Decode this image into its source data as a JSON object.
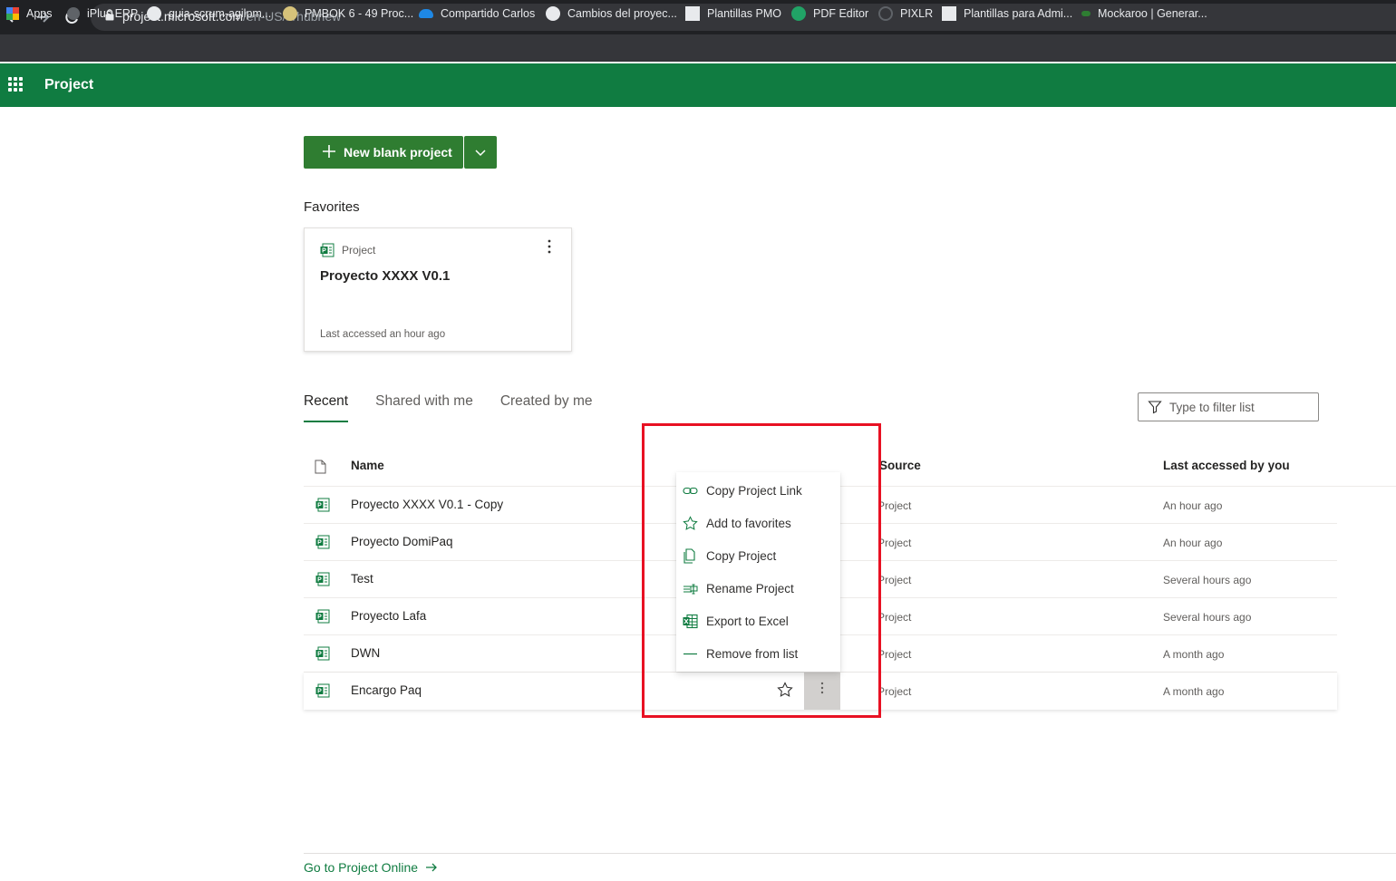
{
  "browser": {
    "url_host": "project.microsoft.com",
    "url_path": "/en-US/#/hubnew",
    "bookmarks": [
      {
        "label": "Apps",
        "icon": "apps-grid-icon",
        "color": "#ea4335"
      },
      {
        "label": "iPlus ERP",
        "icon": "link-icon",
        "color": "#5f6368"
      },
      {
        "label": "guia-scrum-agilpm...",
        "icon": "globe-icon",
        "color": "#e8eaed"
      },
      {
        "label": "PMBOK 6 - 49 Proc...",
        "icon": "avatar-icon",
        "color": "#d6c27a"
      },
      {
        "label": "Compartido Carlos",
        "icon": "onedrive-icon",
        "color": "#1e88e5"
      },
      {
        "label": "Cambios del proyec...",
        "icon": "wordpress-icon",
        "color": "#e8eaed"
      },
      {
        "label": "Plantillas PMO",
        "icon": "qr-icon",
        "color": "#e8eaed"
      },
      {
        "label": "PDF Editor",
        "icon": "pdf-editor-icon",
        "color": "#21a366"
      },
      {
        "label": "PIXLR",
        "icon": "pixlr-icon",
        "color": "#5f6368"
      },
      {
        "label": "Plantillas para Admi...",
        "icon": "page-icon",
        "color": "#e8eaed"
      },
      {
        "label": "Mockaroo | Generar...",
        "icon": "leaf-icon",
        "color": "#2e7d32"
      }
    ]
  },
  "appbar": {
    "title": "Project",
    "color": "#107c41"
  },
  "actions": {
    "new_label": "New blank project"
  },
  "favorites": {
    "section_title": "Favorites",
    "card": {
      "type": "Project",
      "name": "Proyecto XXXX V0.1",
      "last_accessed": "Last accessed an hour ago"
    }
  },
  "tabs": [
    {
      "label": "Recent",
      "active": true
    },
    {
      "label": "Shared with me",
      "active": false
    },
    {
      "label": "Created by me",
      "active": false
    }
  ],
  "filter": {
    "placeholder": "Type to filter list"
  },
  "table": {
    "headers": {
      "name": "Name",
      "source": "Source",
      "last": "Last accessed by you"
    },
    "rows": [
      {
        "name": "Proyecto XXXX V0.1 - Copy",
        "source": "Project",
        "last": "An hour ago"
      },
      {
        "name": "Proyecto DomiPaq",
        "source": "Project",
        "last": "An hour ago"
      },
      {
        "name": "Test",
        "source": "Project",
        "last": "Several hours ago"
      },
      {
        "name": "Proyecto Lafa",
        "source": "Project",
        "last": "Several hours ago"
      },
      {
        "name": "DWN",
        "source": "Project",
        "last": "A month ago"
      },
      {
        "name": "Encargo Paq",
        "source": "Project",
        "last": "A month ago"
      }
    ]
  },
  "context_menu": {
    "items": [
      {
        "label": "Copy Project Link",
        "icon": "link-icon"
      },
      {
        "label": "Add to favorites",
        "icon": "star-icon"
      },
      {
        "label": "Copy Project",
        "icon": "copy-icon"
      },
      {
        "label": "Rename Project",
        "icon": "rename-icon"
      },
      {
        "label": "Export to Excel",
        "icon": "excel-icon"
      },
      {
        "label": "Remove from list",
        "icon": "remove-icon"
      }
    ]
  },
  "footer": {
    "link_label": "Go to Project Online"
  },
  "colors": {
    "accent": "#107c41",
    "highlight_box": "#e81123",
    "button": "#2f7d31"
  }
}
